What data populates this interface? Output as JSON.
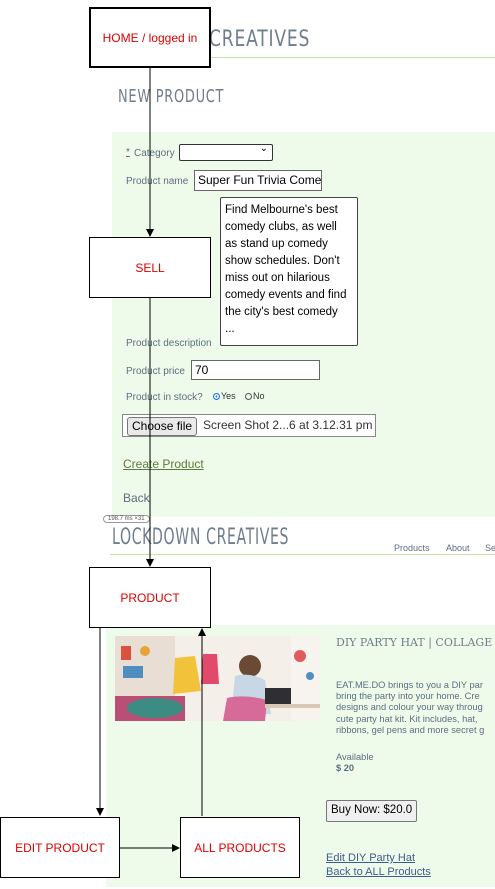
{
  "top_screen": {
    "brand_fragment": "CREATIVES",
    "heading": "NEW PRODUCT",
    "required_marker": "*",
    "label_category": "Category",
    "category_arrow": "⌄",
    "label_product_name": "Product name",
    "product_name_value": "Super Fun Trivia Come",
    "description_value": "Find Melbourne's best\ncomedy clubs, as well\nas stand up comedy\nshow schedules. Don't\nmiss out on hilarious\ncomedy events and find\nthe city's best comedy\n...",
    "label_description": "Product description",
    "label_price": "Product price",
    "price_value": "70",
    "label_stock": "Product in stock?",
    "stock_yes": "Yes",
    "stock_no": "No",
    "choose_file": "Choose file",
    "file_name": "Screen Shot 2...6 at 3.12.31 pm",
    "create_link": "Create Product",
    "back_link": "Back",
    "timing_badge": "198.7 ms ×31"
  },
  "bottom_screen": {
    "brand": "LOCKDOWN CREATIVES",
    "nav": [
      "Products",
      "About",
      "Se"
    ],
    "product_title": "DIY PARTY HAT | COLLAGE",
    "description": "EAT.ME.DO brings to you a DIY par\nbring the party into your home. Cre\ndesigns and colour your way throug\ncute party hat kit. Kit includes, hat,\nribbons, gel pens and more secret g",
    "available": "Available",
    "price": "$ 20",
    "buy_button": "Buy Now: $20.0",
    "edit_link": "Edit DIY Party Hat",
    "back_link": "Back to ALL Products"
  },
  "diagram": {
    "home_box": "HOME / logged in",
    "sell_box": "SELL",
    "product_box": "PRODUCT",
    "edit_box": "EDIT PRODUCT",
    "all_box": "ALL PRODUCTS"
  },
  "colors": {
    "panel_green": "#eefbea",
    "label_text": "#e00000",
    "link_green": "#5b7a3a",
    "link_blue": "#3d5d8f"
  }
}
